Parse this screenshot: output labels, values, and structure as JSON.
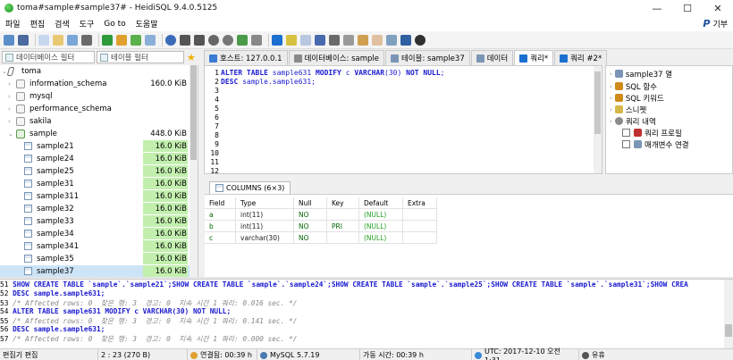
{
  "window": {
    "title": "toma#sample#sample37# - HeidiSQL 9.4.0.5125",
    "controls": [
      "—",
      "☐",
      "✕"
    ]
  },
  "menu": {
    "items": [
      "파일",
      "편집",
      "검색",
      "도구",
      "Go to",
      "도움말"
    ],
    "donate": "기부"
  },
  "filters": {
    "db_filter_placeholder": "데이터베이스 필터",
    "table_filter_placeholder": "테이블 필터"
  },
  "tabs": [
    {
      "label": "호스트: 127.0.0.1",
      "icon_color": "#3a7bd5"
    },
    {
      "label": "데이터베이스: sample",
      "icon_color": "#8a8a8a"
    },
    {
      "label": "테이블: sample37",
      "icon_color": "#7a95b5"
    },
    {
      "label": "데이터",
      "icon_color": "#7a95b5"
    },
    {
      "label": "쿼리*",
      "icon_color": "#1a6fd0"
    },
    {
      "label": "쿼리 #2*",
      "icon_color": "#1a6fd0"
    }
  ],
  "tree": {
    "root": "toma",
    "databases": [
      {
        "name": "information_schema",
        "size": "160.0 KiB"
      },
      {
        "name": "mysql",
        "size": ""
      },
      {
        "name": "performance_schema",
        "size": ""
      },
      {
        "name": "sakila",
        "size": ""
      },
      {
        "name": "sample",
        "size": "448.0 KiB"
      }
    ],
    "tables": [
      {
        "name": "sample21",
        "size": "16.0 KiB"
      },
      {
        "name": "sample24",
        "size": "16.0 KiB"
      },
      {
        "name": "sample25",
        "size": "16.0 KiB"
      },
      {
        "name": "sample31",
        "size": "16.0 KiB"
      },
      {
        "name": "sample311",
        "size": "16.0 KiB"
      },
      {
        "name": "sample32",
        "size": "16.0 KiB"
      },
      {
        "name": "sample33",
        "size": "16.0 KiB"
      },
      {
        "name": "sample34",
        "size": "16.0 KiB"
      },
      {
        "name": "sample341",
        "size": "16.0 KiB"
      },
      {
        "name": "sample35",
        "size": "16.0 KiB"
      },
      {
        "name": "sample37",
        "size": "16.0 KiB"
      }
    ]
  },
  "editor": {
    "line_numbers": [
      "1",
      "2",
      "3",
      "4",
      "5",
      "6",
      "7",
      "8",
      "9",
      "10",
      "11",
      "12"
    ],
    "line1": {
      "kw1": "ALTER TABLE",
      "t1": " sample631 ",
      "kw2": "MODIFY",
      "t2": " c ",
      "kw3": "VARCHAR",
      "t3": "(30) ",
      "kw4": "NOT NULL",
      "t4": ";"
    },
    "line2": {
      "kw1": "DESC",
      "t1": " sample.sample631;"
    }
  },
  "helper": {
    "items": [
      {
        "label": "sample37 열",
        "kind": "tree",
        "icon_color": "#7a95b5"
      },
      {
        "label": "SQL 함수",
        "kind": "tree",
        "icon_color": "#d08a1a"
      },
      {
        "label": "SQL 키워드",
        "kind": "tree",
        "icon_color": "#d08a1a"
      },
      {
        "label": "스니펫",
        "kind": "tree",
        "icon_color": "#d6b84a"
      },
      {
        "label": "쿼리 내역",
        "kind": "tree",
        "icon_color": "#8a8a8a"
      },
      {
        "label": "쿼리 프로필",
        "kind": "check",
        "icon_color": "#c03030"
      },
      {
        "label": "매개변수 연결",
        "kind": "check",
        "icon_color": "#7a95b5"
      }
    ]
  },
  "result": {
    "tab_label": "COLUMNS (6×3)",
    "headers": [
      "Field",
      "Type",
      "Null",
      "Key",
      "Default",
      "Extra"
    ],
    "rows": [
      [
        "a",
        "int(11)",
        "NO",
        "",
        "(NULL)",
        ""
      ],
      [
        "b",
        "int(11)",
        "NO",
        "PRI",
        "(NULL)",
        ""
      ],
      [
        "c",
        "varchar(30)",
        "NO",
        "",
        "(NULL)",
        ""
      ]
    ]
  },
  "log": {
    "lines": [
      {
        "n": "51",
        "sql": "SHOW CREATE TABLE `sample`.`sample21`;SHOW CREATE TABLE `sample`.`sample24`;SHOW CREATE TABLE `sample`.`sample25`;SHOW CREATE TABLE `sample`.`sample31`;SHOW CREA",
        "comment": ""
      },
      {
        "n": "52",
        "sql": "DESC sample.sample631;",
        "comment": ""
      },
      {
        "n": "53",
        "sql": "",
        "comment": "/* Affected rows: 0  찾은 행: 3  경고: 0  지속 시간 1 쿼리: 0.016 sec. */"
      },
      {
        "n": "54",
        "sql": "ALTER TABLE sample631 MODIFY c VARCHAR(30) NOT NULL;",
        "comment": ""
      },
      {
        "n": "55",
        "sql": "",
        "comment": "/* Affected rows: 0  찾은 행: 3  경고: 0  지속 시간 1 쿼리: 0.141 sec. */"
      },
      {
        "n": "56",
        "sql": "DESC sample.sample631;",
        "comment": ""
      },
      {
        "n": "57",
        "sql": "",
        "comment": "/* Affected rows: 0  찾은 행: 3  경고: 0  지속 시간 1 쿼리: 0.000 sec. */"
      }
    ]
  },
  "status": {
    "mode": "편집기 편집",
    "position": "2 : 23 (270 B)",
    "connected": "연결됨: 00:39 h",
    "server": "MySQL 5.7.19",
    "uptime": "가동 시간: 00:39 h",
    "utc": "UTC: 2017-12-10 오전 1:31",
    "idle": "유휴"
  }
}
